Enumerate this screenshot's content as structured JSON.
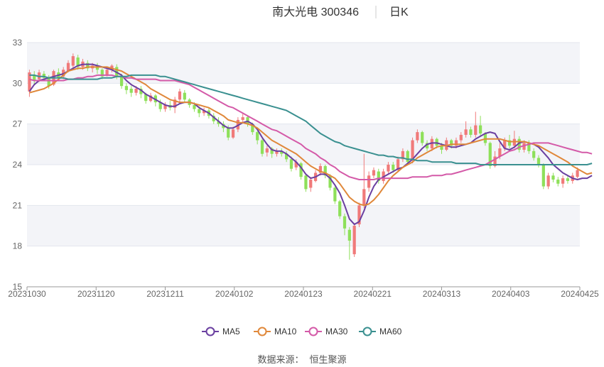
{
  "header": {
    "stock": "南大光电 300346",
    "period": "日K"
  },
  "legend": [
    {
      "name": "MA5",
      "color": "#6a3fa0"
    },
    {
      "name": "MA10",
      "color": "#e0883a"
    },
    {
      "name": "MA30",
      "color": "#d45aa8"
    },
    {
      "name": "MA60",
      "color": "#3a9090"
    }
  ],
  "source": {
    "label": "数据来源：",
    "value": "恒生聚源"
  },
  "chart_data": {
    "type": "candlestick",
    "title": "南大光电 300346 日K",
    "ylim": [
      15,
      33
    ],
    "yticks": [
      15,
      18,
      21,
      24,
      27,
      30,
      33
    ],
    "xtick_labels": [
      "20231030",
      "20231120",
      "20231211",
      "20240102",
      "20240123",
      "20240221",
      "20240313",
      "20240403",
      "20240425"
    ],
    "up_color": "#f07a7a",
    "down_color": "#8ee05a",
    "grid": true,
    "legend_position": "bottom",
    "candles": [
      {
        "o": 29.4,
        "c": 30.8,
        "h": 31.0,
        "l": 29.0
      },
      {
        "o": 30.6,
        "c": 30.2,
        "h": 30.9,
        "l": 29.9
      },
      {
        "o": 30.3,
        "c": 30.8,
        "h": 31.0,
        "l": 30.1
      },
      {
        "o": 30.7,
        "c": 30.4,
        "h": 30.9,
        "l": 30.2
      },
      {
        "o": 30.4,
        "c": 29.8,
        "h": 30.6,
        "l": 29.6
      },
      {
        "o": 29.9,
        "c": 30.9,
        "h": 31.0,
        "l": 29.8
      },
      {
        "o": 30.8,
        "c": 30.4,
        "h": 31.1,
        "l": 30.3
      },
      {
        "o": 30.5,
        "c": 31.0,
        "h": 31.2,
        "l": 30.3
      },
      {
        "o": 30.9,
        "c": 31.5,
        "h": 31.7,
        "l": 30.8
      },
      {
        "o": 31.3,
        "c": 32.0,
        "h": 32.2,
        "l": 31.1
      },
      {
        "o": 31.9,
        "c": 31.2,
        "h": 32.1,
        "l": 31.0
      },
      {
        "o": 31.2,
        "c": 31.6,
        "h": 31.8,
        "l": 31.0
      },
      {
        "o": 31.5,
        "c": 31.1,
        "h": 31.7,
        "l": 30.9
      },
      {
        "o": 31.1,
        "c": 31.3,
        "h": 31.5,
        "l": 30.8
      },
      {
        "o": 31.3,
        "c": 31.0,
        "h": 31.5,
        "l": 30.7
      },
      {
        "o": 31.0,
        "c": 30.5,
        "h": 31.1,
        "l": 30.3
      },
      {
        "o": 30.6,
        "c": 31.0,
        "h": 31.2,
        "l": 30.5
      },
      {
        "o": 31.0,
        "c": 31.3,
        "h": 31.4,
        "l": 30.8
      },
      {
        "o": 31.2,
        "c": 30.5,
        "h": 31.4,
        "l": 30.3
      },
      {
        "o": 30.5,
        "c": 29.8,
        "h": 30.7,
        "l": 29.6
      },
      {
        "o": 29.8,
        "c": 29.5,
        "h": 30.0,
        "l": 29.2
      },
      {
        "o": 29.6,
        "c": 29.3,
        "h": 29.8,
        "l": 29.0
      },
      {
        "o": 29.3,
        "c": 29.6,
        "h": 29.8,
        "l": 29.1
      },
      {
        "o": 29.6,
        "c": 29.2,
        "h": 29.8,
        "l": 28.9
      },
      {
        "o": 29.2,
        "c": 28.7,
        "h": 29.3,
        "l": 28.5
      },
      {
        "o": 28.7,
        "c": 29.1,
        "h": 29.3,
        "l": 28.6
      },
      {
        "o": 29.1,
        "c": 28.6,
        "h": 29.2,
        "l": 28.3
      },
      {
        "o": 28.6,
        "c": 28.1,
        "h": 28.8,
        "l": 27.9
      },
      {
        "o": 28.1,
        "c": 28.4,
        "h": 28.6,
        "l": 27.9
      },
      {
        "o": 28.4,
        "c": 28.2,
        "h": 28.7,
        "l": 28.0
      },
      {
        "o": 28.2,
        "c": 28.8,
        "h": 29.0,
        "l": 27.8
      },
      {
        "o": 28.8,
        "c": 29.4,
        "h": 29.6,
        "l": 28.6
      },
      {
        "o": 29.3,
        "c": 28.8,
        "h": 29.5,
        "l": 28.6
      },
      {
        "o": 28.8,
        "c": 28.4,
        "h": 28.9,
        "l": 28.2
      },
      {
        "o": 28.4,
        "c": 28.1,
        "h": 28.6,
        "l": 27.9
      },
      {
        "o": 28.1,
        "c": 27.8,
        "h": 28.3,
        "l": 27.5
      },
      {
        "o": 27.8,
        "c": 28.0,
        "h": 28.2,
        "l": 27.6
      },
      {
        "o": 28.0,
        "c": 27.6,
        "h": 28.2,
        "l": 27.4
      },
      {
        "o": 27.6,
        "c": 27.2,
        "h": 27.8,
        "l": 27.0
      },
      {
        "o": 27.2,
        "c": 27.0,
        "h": 27.5,
        "l": 26.8
      },
      {
        "o": 27.0,
        "c": 26.7,
        "h": 27.2,
        "l": 26.4
      },
      {
        "o": 26.7,
        "c": 26.0,
        "h": 26.9,
        "l": 25.8
      },
      {
        "o": 26.0,
        "c": 26.6,
        "h": 26.8,
        "l": 25.9
      },
      {
        "o": 26.6,
        "c": 27.3,
        "h": 27.5,
        "l": 26.4
      },
      {
        "o": 27.3,
        "c": 27.5,
        "h": 27.8,
        "l": 27.1
      },
      {
        "o": 27.5,
        "c": 27.0,
        "h": 27.6,
        "l": 26.8
      },
      {
        "o": 27.0,
        "c": 26.4,
        "h": 27.1,
        "l": 26.2
      },
      {
        "o": 26.4,
        "c": 25.8,
        "h": 26.5,
        "l": 25.5
      },
      {
        "o": 25.8,
        "c": 24.8,
        "h": 25.9,
        "l": 24.6
      },
      {
        "o": 24.9,
        "c": 25.2,
        "h": 25.4,
        "l": 24.6
      },
      {
        "o": 25.2,
        "c": 24.8,
        "h": 25.3,
        "l": 24.5
      },
      {
        "o": 24.8,
        "c": 25.0,
        "h": 25.2,
        "l": 24.6
      },
      {
        "o": 25.0,
        "c": 24.8,
        "h": 25.2,
        "l": 24.6
      },
      {
        "o": 24.8,
        "c": 24.4,
        "h": 25.0,
        "l": 24.2
      },
      {
        "o": 24.4,
        "c": 23.7,
        "h": 24.6,
        "l": 23.5
      },
      {
        "o": 23.8,
        "c": 24.2,
        "h": 24.4,
        "l": 23.6
      },
      {
        "o": 24.1,
        "c": 23.1,
        "h": 24.2,
        "l": 22.9
      },
      {
        "o": 23.2,
        "c": 22.2,
        "h": 23.3,
        "l": 22.0
      },
      {
        "o": 22.3,
        "c": 22.9,
        "h": 23.1,
        "l": 22.0
      },
      {
        "o": 22.8,
        "c": 23.4,
        "h": 23.6,
        "l": 22.7
      },
      {
        "o": 23.4,
        "c": 23.9,
        "h": 24.1,
        "l": 23.2
      },
      {
        "o": 23.9,
        "c": 23.2,
        "h": 24.0,
        "l": 23.0
      },
      {
        "o": 23.2,
        "c": 22.3,
        "h": 23.3,
        "l": 22.1
      },
      {
        "o": 22.3,
        "c": 21.3,
        "h": 22.4,
        "l": 21.1
      },
      {
        "o": 21.3,
        "c": 20.2,
        "h": 21.4,
        "l": 20.0
      },
      {
        "o": 20.2,
        "c": 19.3,
        "h": 20.4,
        "l": 18.8
      },
      {
        "o": 19.2,
        "c": 18.4,
        "h": 19.4,
        "l": 17.0
      },
      {
        "o": 17.4,
        "c": 19.5,
        "h": 19.7,
        "l": 17.2
      },
      {
        "o": 19.6,
        "c": 21.0,
        "h": 21.2,
        "l": 19.4
      },
      {
        "o": 21.0,
        "c": 22.2,
        "h": 24.8,
        "l": 20.8
      },
      {
        "o": 22.3,
        "c": 23.2,
        "h": 23.5,
        "l": 22.0
      },
      {
        "o": 23.2,
        "c": 23.6,
        "h": 23.8,
        "l": 23.0
      },
      {
        "o": 23.5,
        "c": 22.8,
        "h": 23.7,
        "l": 22.6
      },
      {
        "o": 22.8,
        "c": 23.5,
        "h": 23.7,
        "l": 22.6
      },
      {
        "o": 23.5,
        "c": 24.0,
        "h": 24.2,
        "l": 23.3
      },
      {
        "o": 24.0,
        "c": 23.6,
        "h": 24.2,
        "l": 23.4
      },
      {
        "o": 23.6,
        "c": 24.4,
        "h": 24.6,
        "l": 23.5
      },
      {
        "o": 24.4,
        "c": 25.0,
        "h": 25.2,
        "l": 24.2
      },
      {
        "o": 25.0,
        "c": 24.2,
        "h": 25.1,
        "l": 24.0
      },
      {
        "o": 24.3,
        "c": 25.8,
        "h": 26.0,
        "l": 24.1
      },
      {
        "o": 25.8,
        "c": 26.4,
        "h": 26.6,
        "l": 25.6
      },
      {
        "o": 26.4,
        "c": 25.6,
        "h": 26.5,
        "l": 25.4
      },
      {
        "o": 25.6,
        "c": 25.2,
        "h": 25.8,
        "l": 25.0
      },
      {
        "o": 25.2,
        "c": 25.9,
        "h": 26.1,
        "l": 25.0
      },
      {
        "o": 25.9,
        "c": 25.4,
        "h": 26.0,
        "l": 25.2
      },
      {
        "o": 25.4,
        "c": 25.1,
        "h": 25.6,
        "l": 24.8
      },
      {
        "o": 25.1,
        "c": 25.8,
        "h": 26.0,
        "l": 25.0
      },
      {
        "o": 25.8,
        "c": 25.4,
        "h": 25.9,
        "l": 25.2
      },
      {
        "o": 25.4,
        "c": 25.8,
        "h": 26.0,
        "l": 25.2
      },
      {
        "o": 25.8,
        "c": 26.2,
        "h": 26.4,
        "l": 25.6
      },
      {
        "o": 26.2,
        "c": 26.6,
        "h": 27.2,
        "l": 26.0
      },
      {
        "o": 26.6,
        "c": 26.2,
        "h": 26.8,
        "l": 26.0
      },
      {
        "o": 26.2,
        "c": 26.9,
        "h": 27.9,
        "l": 26.0
      },
      {
        "o": 26.9,
        "c": 26.3,
        "h": 27.6,
        "l": 26.1
      },
      {
        "o": 26.3,
        "c": 25.6,
        "h": 26.4,
        "l": 25.4
      },
      {
        "o": 25.6,
        "c": 23.9,
        "h": 25.7,
        "l": 23.7
      },
      {
        "o": 23.9,
        "c": 24.6,
        "h": 25.0,
        "l": 23.8
      },
      {
        "o": 24.6,
        "c": 25.2,
        "h": 25.6,
        "l": 24.4
      },
      {
        "o": 25.2,
        "c": 25.8,
        "h": 26.0,
        "l": 25.0
      },
      {
        "o": 25.8,
        "c": 25.4,
        "h": 26.2,
        "l": 25.2
      },
      {
        "o": 25.4,
        "c": 25.9,
        "h": 26.5,
        "l": 25.2
      },
      {
        "o": 25.9,
        "c": 25.1,
        "h": 26.1,
        "l": 24.9
      },
      {
        "o": 25.1,
        "c": 25.6,
        "h": 25.8,
        "l": 24.9
      },
      {
        "o": 25.6,
        "c": 25.0,
        "h": 25.8,
        "l": 24.8
      },
      {
        "o": 25.0,
        "c": 24.5,
        "h": 25.2,
        "l": 24.3
      },
      {
        "o": 24.5,
        "c": 24.0,
        "h": 24.7,
        "l": 23.8
      },
      {
        "o": 24.0,
        "c": 22.4,
        "h": 24.1,
        "l": 22.2
      },
      {
        "o": 22.4,
        "c": 23.2,
        "h": 23.4,
        "l": 22.2
      },
      {
        "o": 23.2,
        "c": 22.9,
        "h": 23.4,
        "l": 22.7
      },
      {
        "o": 22.9,
        "c": 22.6,
        "h": 23.1,
        "l": 22.4
      },
      {
        "o": 22.6,
        "c": 23.0,
        "h": 23.2,
        "l": 22.3
      },
      {
        "o": 23.0,
        "c": 22.8,
        "h": 23.2,
        "l": 22.6
      },
      {
        "o": 22.8,
        "c": 23.2,
        "h": 23.4,
        "l": 22.6
      },
      {
        "o": 23.1,
        "c": 23.6,
        "h": 23.8,
        "l": 23.0
      }
    ],
    "series": [
      {
        "name": "MA5",
        "color": "#6a3fa0",
        "values": [
          29.4,
          29.9,
          30.2,
          30.3,
          30.4,
          30.5,
          30.6,
          30.7,
          30.9,
          31.1,
          31.3,
          31.4,
          31.4,
          31.4,
          31.3,
          31.2,
          31.1,
          31.0,
          30.8,
          30.6,
          30.2,
          29.9,
          29.7,
          29.5,
          29.2,
          29.0,
          28.8,
          28.6,
          28.4,
          28.3,
          28.3,
          28.5,
          28.6,
          28.6,
          28.5,
          28.2,
          28.0,
          27.8,
          27.5,
          27.2,
          26.9,
          26.7,
          26.7,
          26.9,
          27.1,
          27.2,
          27.0,
          26.6,
          26.0,
          25.5,
          25.1,
          25.0,
          25.0,
          24.8,
          24.5,
          24.2,
          23.8,
          23.3,
          23.0,
          23.1,
          23.3,
          23.3,
          23.0,
          22.5,
          21.9,
          21.0,
          20.0,
          19.6,
          19.8,
          20.6,
          21.6,
          22.4,
          22.9,
          23.1,
          23.3,
          23.5,
          23.7,
          23.8,
          24.1,
          24.4,
          24.8,
          25.2,
          25.5,
          25.6,
          25.6,
          25.5,
          25.4,
          25.3,
          25.3,
          25.4,
          25.5,
          25.6,
          25.9,
          26.1,
          26.3,
          26.4,
          26.3,
          25.7,
          25.2,
          25.1,
          25.3,
          25.6,
          25.7,
          25.6,
          25.5,
          25.3,
          24.9,
          24.5,
          24.0,
          23.7,
          23.4,
          23.2,
          23.0,
          22.9,
          23.0,
          23.0,
          23.2
        ]
      },
      {
        "name": "MA10",
        "color": "#e0883a",
        "values": [
          29.3,
          29.4,
          29.5,
          29.6,
          29.8,
          30.0,
          30.3,
          30.6,
          30.9,
          31.0,
          31.1,
          31.1,
          31.2,
          31.2,
          31.2,
          31.2,
          31.2,
          31.1,
          31.0,
          30.9,
          30.7,
          30.5,
          30.3,
          30.1,
          29.9,
          29.6,
          29.4,
          29.2,
          29.0,
          28.8,
          28.7,
          28.6,
          28.6,
          28.6,
          28.5,
          28.4,
          28.3,
          28.2,
          28.0,
          27.8,
          27.6,
          27.3,
          27.2,
          27.1,
          27.1,
          27.0,
          26.9,
          26.7,
          26.4,
          26.1,
          25.8,
          25.6,
          25.4,
          25.2,
          25.0,
          24.8,
          24.5,
          24.2,
          23.9,
          23.7,
          23.5,
          23.4,
          23.2,
          23.0,
          22.6,
          22.1,
          21.6,
          21.3,
          21.1,
          21.0,
          21.1,
          21.4,
          21.8,
          22.3,
          22.8,
          23.2,
          23.5,
          23.8,
          24.0,
          24.2,
          24.5,
          24.7,
          24.9,
          25.1,
          25.3,
          25.4,
          25.4,
          25.5,
          25.5,
          25.5,
          25.5,
          25.6,
          25.7,
          25.8,
          25.9,
          25.9,
          25.9,
          25.9,
          25.8,
          25.7,
          25.7,
          25.7,
          25.7,
          25.6,
          25.5,
          25.4,
          25.2,
          25.0,
          24.8,
          24.6,
          24.4,
          24.2,
          23.9,
          23.7,
          23.5,
          23.3,
          23.4
        ]
      },
      {
        "name": "MA30",
        "color": "#d45aa8",
        "values": [
          30.3,
          30.2,
          30.2,
          30.2,
          30.2,
          30.2,
          30.2,
          30.2,
          30.3,
          30.3,
          30.4,
          30.4,
          30.5,
          30.5,
          30.6,
          30.6,
          30.6,
          30.6,
          30.5,
          30.5,
          30.4,
          30.4,
          30.3,
          30.3,
          30.3,
          30.3,
          30.3,
          30.2,
          30.2,
          30.2,
          30.2,
          30.1,
          30.0,
          29.9,
          29.7,
          29.5,
          29.3,
          29.1,
          28.9,
          28.7,
          28.5,
          28.3,
          28.2,
          28.0,
          27.8,
          27.6,
          27.4,
          27.2,
          27.0,
          26.8,
          26.6,
          26.5,
          26.3,
          26.1,
          25.9,
          25.7,
          25.5,
          25.2,
          25.0,
          24.8,
          24.5,
          24.3,
          24.0,
          23.8,
          23.5,
          23.3,
          23.1,
          23.0,
          22.9,
          22.9,
          22.9,
          22.9,
          23.0,
          23.0,
          23.0,
          23.0,
          23.0,
          23.0,
          23.0,
          23.1,
          23.1,
          23.1,
          23.1,
          23.2,
          23.2,
          23.2,
          23.3,
          23.3,
          23.4,
          23.5,
          23.6,
          23.7,
          23.8,
          23.9,
          24.0,
          24.2,
          24.4,
          24.6,
          24.8,
          25.0,
          25.1,
          25.3,
          25.4,
          25.5,
          25.6,
          25.6,
          25.6,
          25.6,
          25.5,
          25.4,
          25.3,
          25.2,
          25.1,
          25.0,
          24.9,
          24.9,
          24.8
        ]
      },
      {
        "name": "MA60",
        "color": "#3a9090",
        "values": [
          30.6,
          30.6,
          30.5,
          30.5,
          30.4,
          30.4,
          30.4,
          30.4,
          30.3,
          30.3,
          30.3,
          30.3,
          30.3,
          30.3,
          30.3,
          30.4,
          30.4,
          30.4,
          30.5,
          30.5,
          30.5,
          30.6,
          30.6,
          30.6,
          30.6,
          30.6,
          30.6,
          30.5,
          30.5,
          30.4,
          30.3,
          30.2,
          30.1,
          30.0,
          29.9,
          29.8,
          29.7,
          29.6,
          29.5,
          29.4,
          29.3,
          29.2,
          29.1,
          29.0,
          28.9,
          28.8,
          28.7,
          28.6,
          28.5,
          28.4,
          28.3,
          28.2,
          28.1,
          28.0,
          27.8,
          27.6,
          27.4,
          27.2,
          26.9,
          26.6,
          26.3,
          26.1,
          25.9,
          25.7,
          25.6,
          25.4,
          25.3,
          25.2,
          25.1,
          25.0,
          24.9,
          24.8,
          24.7,
          24.7,
          24.6,
          24.6,
          24.5,
          24.5,
          24.4,
          24.4,
          24.3,
          24.3,
          24.3,
          24.2,
          24.2,
          24.2,
          24.2,
          24.2,
          24.1,
          24.1,
          24.1,
          24.1,
          24.1,
          24.0,
          24.0,
          24.0,
          24.0,
          24.0,
          24.0,
          24.0,
          24.0,
          24.0,
          24.0,
          24.0,
          24.0,
          24.0,
          24.0,
          24.0,
          24.0,
          24.0,
          24.0,
          24.0,
          24.0,
          24.0,
          24.0,
          24.0,
          24.1
        ]
      }
    ]
  }
}
